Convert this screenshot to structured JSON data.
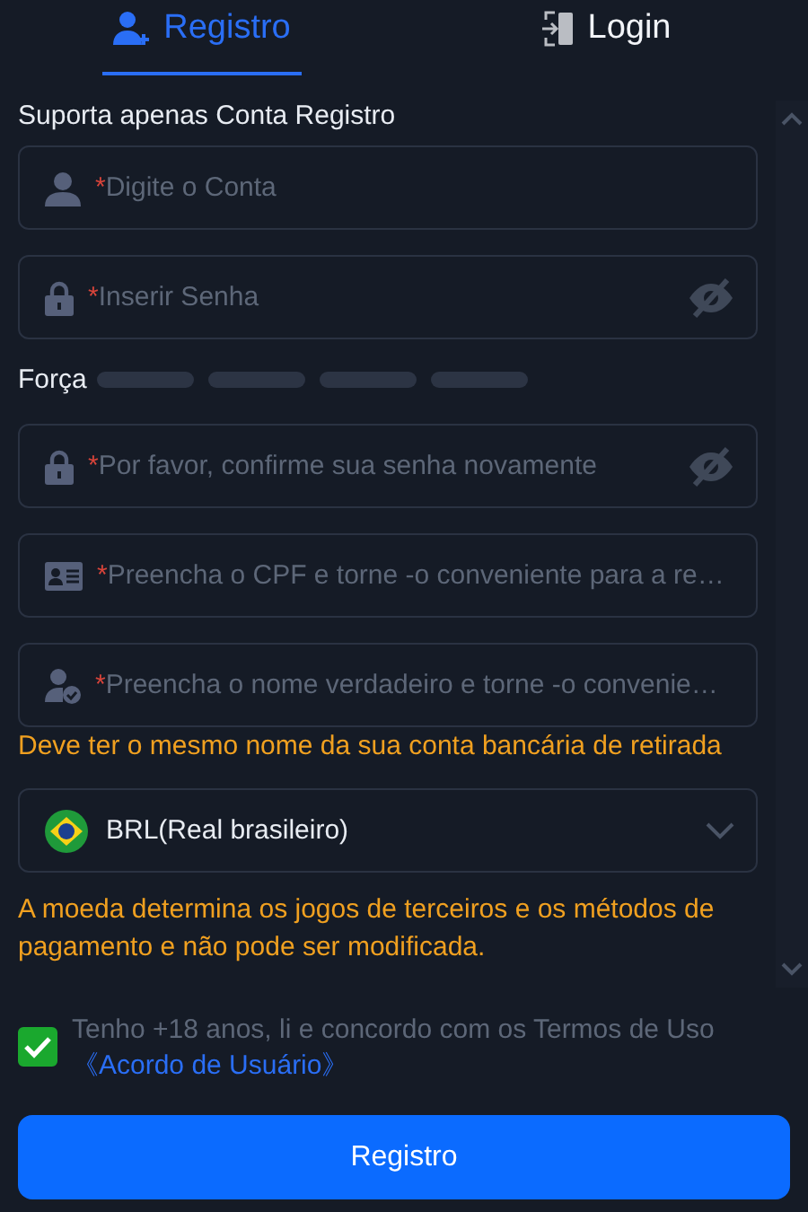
{
  "tabs": [
    {
      "label": "Registro",
      "selected": true
    },
    {
      "label": "Login",
      "selected": false
    }
  ],
  "form": {
    "heading": "Suporta apenas Conta Registro",
    "fields": [
      {
        "kind": "account",
        "mark": "*",
        "placeholder": "Digite o Conta",
        "eye": false
      },
      {
        "kind": "password",
        "mark": "*",
        "placeholder": "Inserir Senha",
        "eye": true
      },
      {
        "kind": "strength",
        "label": "Força"
      },
      {
        "kind": "password",
        "mark": "*",
        "placeholder": "Por favor, confirme sua senha novamente",
        "eye": true
      },
      {
        "kind": "id-card",
        "mark": "*",
        "placeholder": "Preencha o CPF e torne -o conveniente para a re…",
        "eye": false
      },
      {
        "kind": "real-name",
        "mark": "*",
        "placeholder": "Preencha o nome verdadeiro e torne -o convenie…",
        "eye": false
      }
    ],
    "name_hint": "Deve ter o mesmo nome da sua conta bancária de retirada",
    "currency": {
      "value": "BRL(Real brasileiro)"
    },
    "currency_note": "A moeda determina os jogos de terceiros e os métodos de pagamento e não pode ser modificada."
  },
  "agreement": {
    "checked": true,
    "text": "Tenho +18 anos, li e concordo com os Termos de Uso",
    "link": "《Acordo de Usuário》"
  },
  "submit": "Registro"
}
